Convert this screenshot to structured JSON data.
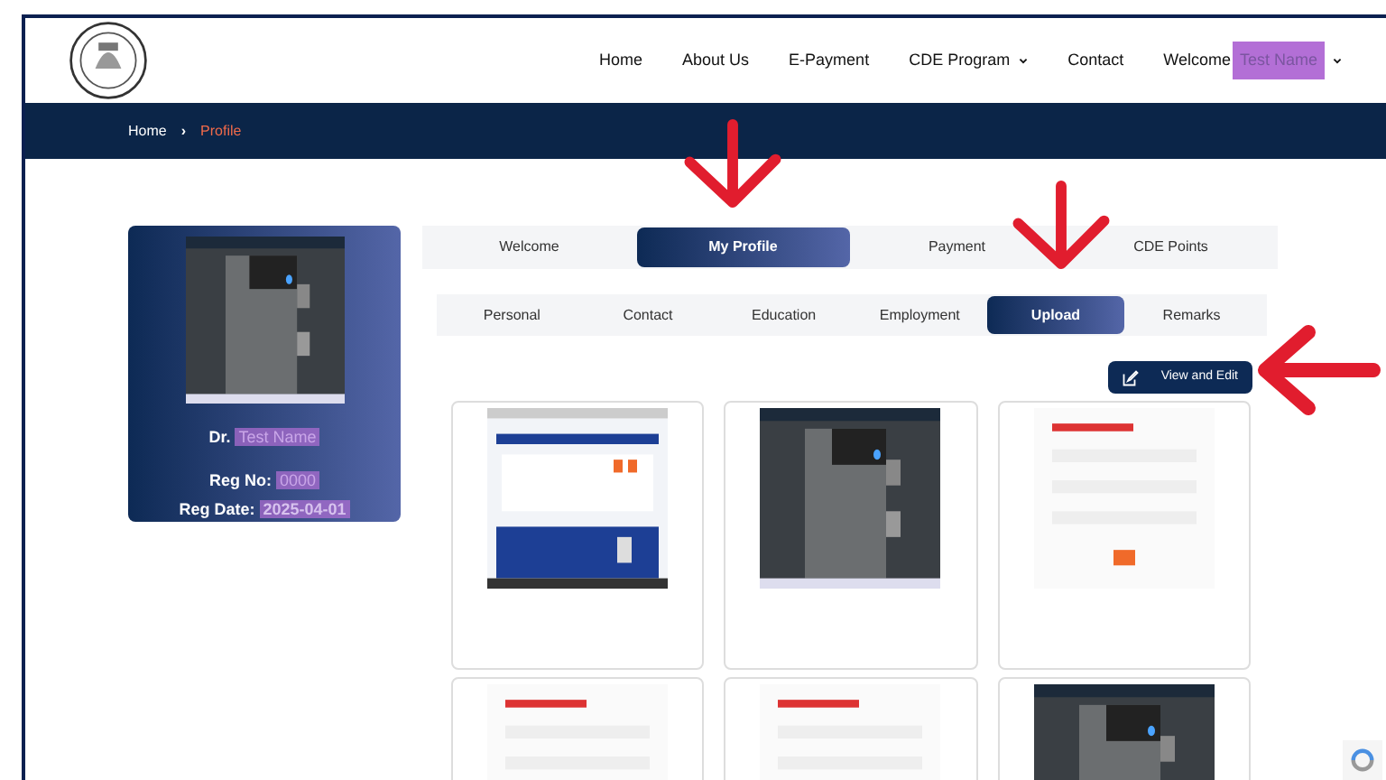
{
  "nav": {
    "items": [
      {
        "label": "Home",
        "dropdown": false
      },
      {
        "label": "About Us",
        "dropdown": false
      },
      {
        "label": "E-Payment",
        "dropdown": false
      },
      {
        "label": "CDE Program",
        "dropdown": true
      },
      {
        "label": "Contact",
        "dropdown": false
      }
    ],
    "welcome": "Welcome",
    "user": "Test Name",
    "highlighted": true
  },
  "breadcrumb": {
    "home": "Home",
    "separator": "›",
    "current": "Profile"
  },
  "profile": {
    "photo": {
      "kind": "dark"
    },
    "title": "Dr.",
    "name": "Test Name",
    "reg_no_label": "Reg No:",
    "reg_no": "0000",
    "reg_date_label": "Reg Date:",
    "reg_date": "2025-04-01",
    "highlighted": true
  },
  "tabs": [
    {
      "label": "Welcome",
      "selected": false
    },
    {
      "label": "My Profile",
      "selected": true
    },
    {
      "label": "Payment",
      "selected": false
    },
    {
      "label": "CDE Points",
      "selected": false
    }
  ],
  "subtabs": [
    {
      "label": "Personal",
      "selected": false
    },
    {
      "label": "Contact",
      "selected": false
    },
    {
      "label": "Education",
      "selected": false
    },
    {
      "label": "Employment",
      "selected": false
    },
    {
      "label": "Upload",
      "selected": true
    },
    {
      "label": "Remarks",
      "selected": false
    }
  ],
  "view_edit_button": "View and Edit",
  "uploads": [
    {
      "kind": "page"
    },
    {
      "kind": "dark"
    },
    {
      "kind": "form"
    },
    {
      "kind": "form"
    },
    {
      "kind": "form"
    },
    {
      "kind": "dark"
    }
  ],
  "annotations": [
    {
      "kind": "arrow-down"
    },
    {
      "kind": "arrow-down"
    },
    {
      "kind": "arrow-left"
    }
  ]
}
